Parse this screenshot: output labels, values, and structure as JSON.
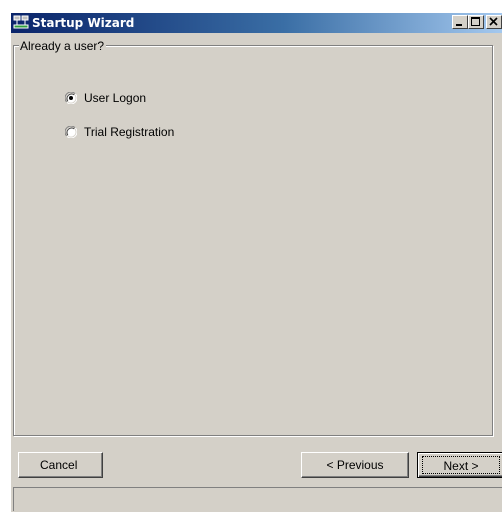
{
  "window": {
    "title": "Startup Wizard",
    "icon": "network-app-icon",
    "controls": {
      "minimize": "minimize-icon",
      "maximize": "maximize-icon",
      "close": "close-icon"
    }
  },
  "group": {
    "legend": "Already a user?",
    "options": [
      {
        "label": "User Logon",
        "selected": true
      },
      {
        "label": "Trial Registration",
        "selected": false
      }
    ]
  },
  "buttons": {
    "cancel": "Cancel",
    "previous": "< Previous",
    "next": "Next >"
  },
  "status": {
    "text": ""
  },
  "colors": {
    "face": "#d4d0c8",
    "titlebar_start": "#0a246a",
    "titlebar_end": "#a6caf0"
  }
}
